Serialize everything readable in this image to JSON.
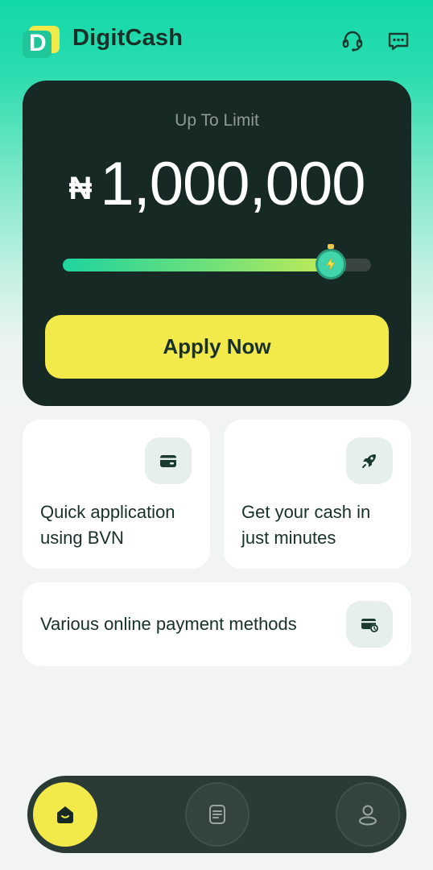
{
  "header": {
    "logo_letter": "D",
    "app_name": "DigitCash",
    "support_icon": "headset-icon",
    "message_icon": "chat-icon"
  },
  "limit_card": {
    "label": "Up To Limit",
    "currency_symbol": "₦",
    "amount": "1,000,000",
    "slider_fraction": 0.87,
    "apply_label": "Apply Now"
  },
  "features": [
    {
      "text": "Quick application using BVN",
      "icon": "card-icon"
    },
    {
      "text": "Get your cash in just minutes",
      "icon": "rocket-icon"
    },
    {
      "text": "Various online payment methods",
      "icon": "payment-card-icon"
    }
  ],
  "bottom_nav": {
    "items": [
      {
        "icon": "home-icon",
        "active": true
      },
      {
        "icon": "orders-icon",
        "active": false
      },
      {
        "icon": "profile-icon",
        "active": false
      }
    ]
  },
  "colors": {
    "accent": "#f2e94a",
    "brand": "#1fc69a",
    "card_dark": "#172924"
  }
}
